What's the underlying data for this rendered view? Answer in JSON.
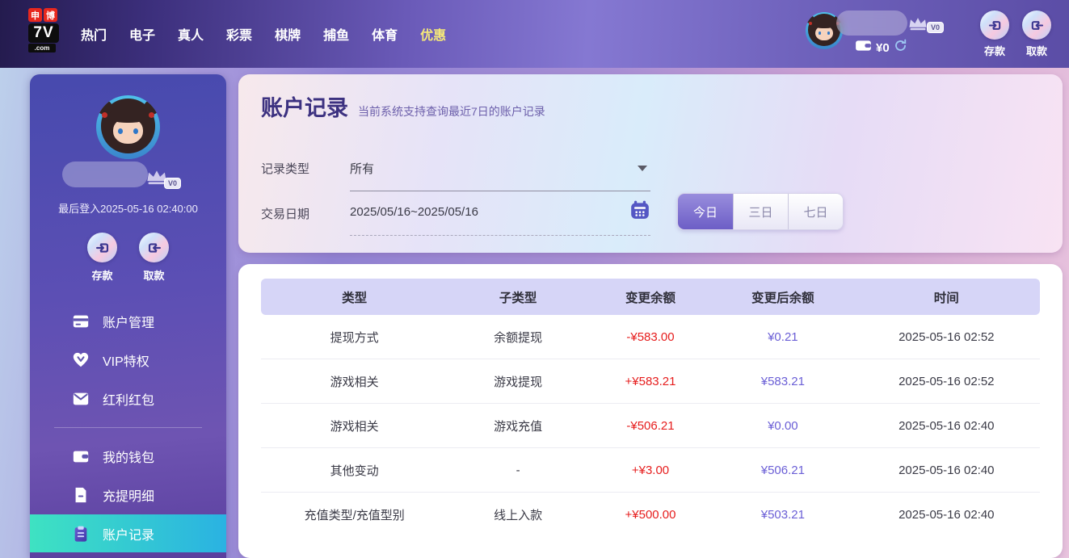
{
  "nav": {
    "logo_top_left": "申",
    "logo_top_right": "博",
    "logo_mid": "7V",
    "logo_bottom": ".com",
    "items": [
      {
        "label": "热门"
      },
      {
        "label": "电子"
      },
      {
        "label": "真人"
      },
      {
        "label": "彩票"
      },
      {
        "label": "棋牌"
      },
      {
        "label": "捕鱼"
      },
      {
        "label": "体育"
      },
      {
        "label": "优惠",
        "highlighted": true
      }
    ],
    "balance": "¥0",
    "vip_badge": "V0",
    "deposit_label": "存款",
    "withdraw_label": "取款"
  },
  "sidebar": {
    "vip_badge": "V0",
    "last_login": "最后登入2025-05-16 02:40:00",
    "deposit_label": "存款",
    "withdraw_label": "取款",
    "menu": [
      {
        "label": "账户管理",
        "icon": "bank-card-icon"
      },
      {
        "label": "VIP特权",
        "icon": "vip-heart-icon"
      },
      {
        "label": "红利红包",
        "icon": "red-envelope-icon"
      },
      {
        "label": "我的钱包",
        "icon": "wallet-icon",
        "group_start": true
      },
      {
        "label": "充提明细",
        "icon": "statement-icon"
      },
      {
        "label": "账户记录",
        "icon": "records-icon",
        "active": true
      }
    ]
  },
  "main": {
    "title": "账户记录",
    "subtitle": "当前系统支持查询最近7日的账户记录",
    "filters": {
      "record_type_label": "记录类型",
      "record_type_value": "所有",
      "date_label": "交易日期",
      "date_value": "2025/05/16~2025/05/16",
      "quick_ranges": [
        {
          "label": "今日",
          "active": true
        },
        {
          "label": "三日",
          "active": false
        },
        {
          "label": "七日",
          "active": false
        }
      ]
    },
    "table": {
      "headers": [
        "类型",
        "子类型",
        "变更余额",
        "变更后余额",
        "时间"
      ],
      "rows": [
        {
          "type": "提现方式",
          "subtype": "余额提现",
          "change": "-¥583.00",
          "after": "¥0.21",
          "time": "2025-05-16 02:52"
        },
        {
          "type": "游戏相关",
          "subtype": "游戏提现",
          "change": "+¥583.21",
          "after": "¥583.21",
          "time": "2025-05-16 02:52"
        },
        {
          "type": "游戏相关",
          "subtype": "游戏充值",
          "change": "-¥506.21",
          "after": "¥0.00",
          "time": "2025-05-16 02:40"
        },
        {
          "type": "其他变动",
          "subtype": "-",
          "change": "+¥3.00",
          "after": "¥506.21",
          "time": "2025-05-16 02:40"
        },
        {
          "type": "充值类型/充值型别",
          "subtype": "线上入款",
          "change": "+¥500.00",
          "after": "¥503.21",
          "time": "2025-05-16 02:40"
        }
      ]
    }
  },
  "colors": {
    "accent_purple": "#6d5ec6",
    "active_menu_gradient_start": "#3ee2c2",
    "active_menu_gradient_end": "#2ab2e2",
    "amount_change": "#e61d1d",
    "amount_after": "#6b5fd6",
    "promo_highlight": "#f5e87a",
    "table_header_bg": "#d6d5f7"
  }
}
